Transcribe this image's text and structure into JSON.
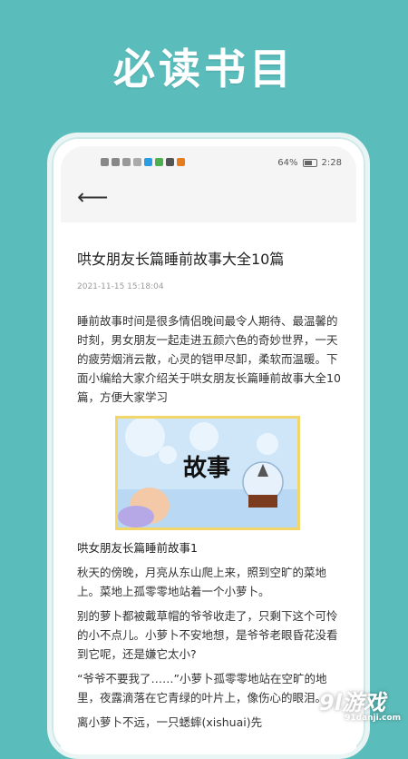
{
  "headline": "必读书目",
  "status": {
    "battery": "64%",
    "time": "2:28"
  },
  "article": {
    "title": "哄女朋友长篇睡前故事大全10篇",
    "date": "2021-11-15 15:18:04",
    "intro": "睡前故事时间是很多情侣晚间最令人期待、最温馨的时刻，男女朋友一起走进五颜六色的奇妙世界，一天的疲劳烟消云散，心灵的铠甲尽卸，柔软而温暖。下面小编给大家介绍关于哄女朋友长篇睡前故事大全10篇，方便大家学习",
    "banner_text": "故事",
    "section_title": "哄女朋友长篇睡前故事1",
    "paragraphs": [
      "秋天的傍晚，月亮从东山爬上来，照到空旷的菜地上。菜地上孤零零地站着一个小萝卜。",
      "别的萝卜都被戴草帽的爷爷收走了，只剩下这个可怜的小不点儿。小萝卜不安地想，是爷爷老眼昏花没看到它呢，还是嫌它太小?",
      "“爷爷不要我了……”小萝卜孤零零地站在空旷的地里，夜露滴落在它青绿的叶片上，像伤心的眼泪。",
      "离小萝卜不远，一只蟋蟀(xishuai)先"
    ]
  },
  "watermark": {
    "main": "9l游戏",
    "sub": "91danji.com"
  }
}
